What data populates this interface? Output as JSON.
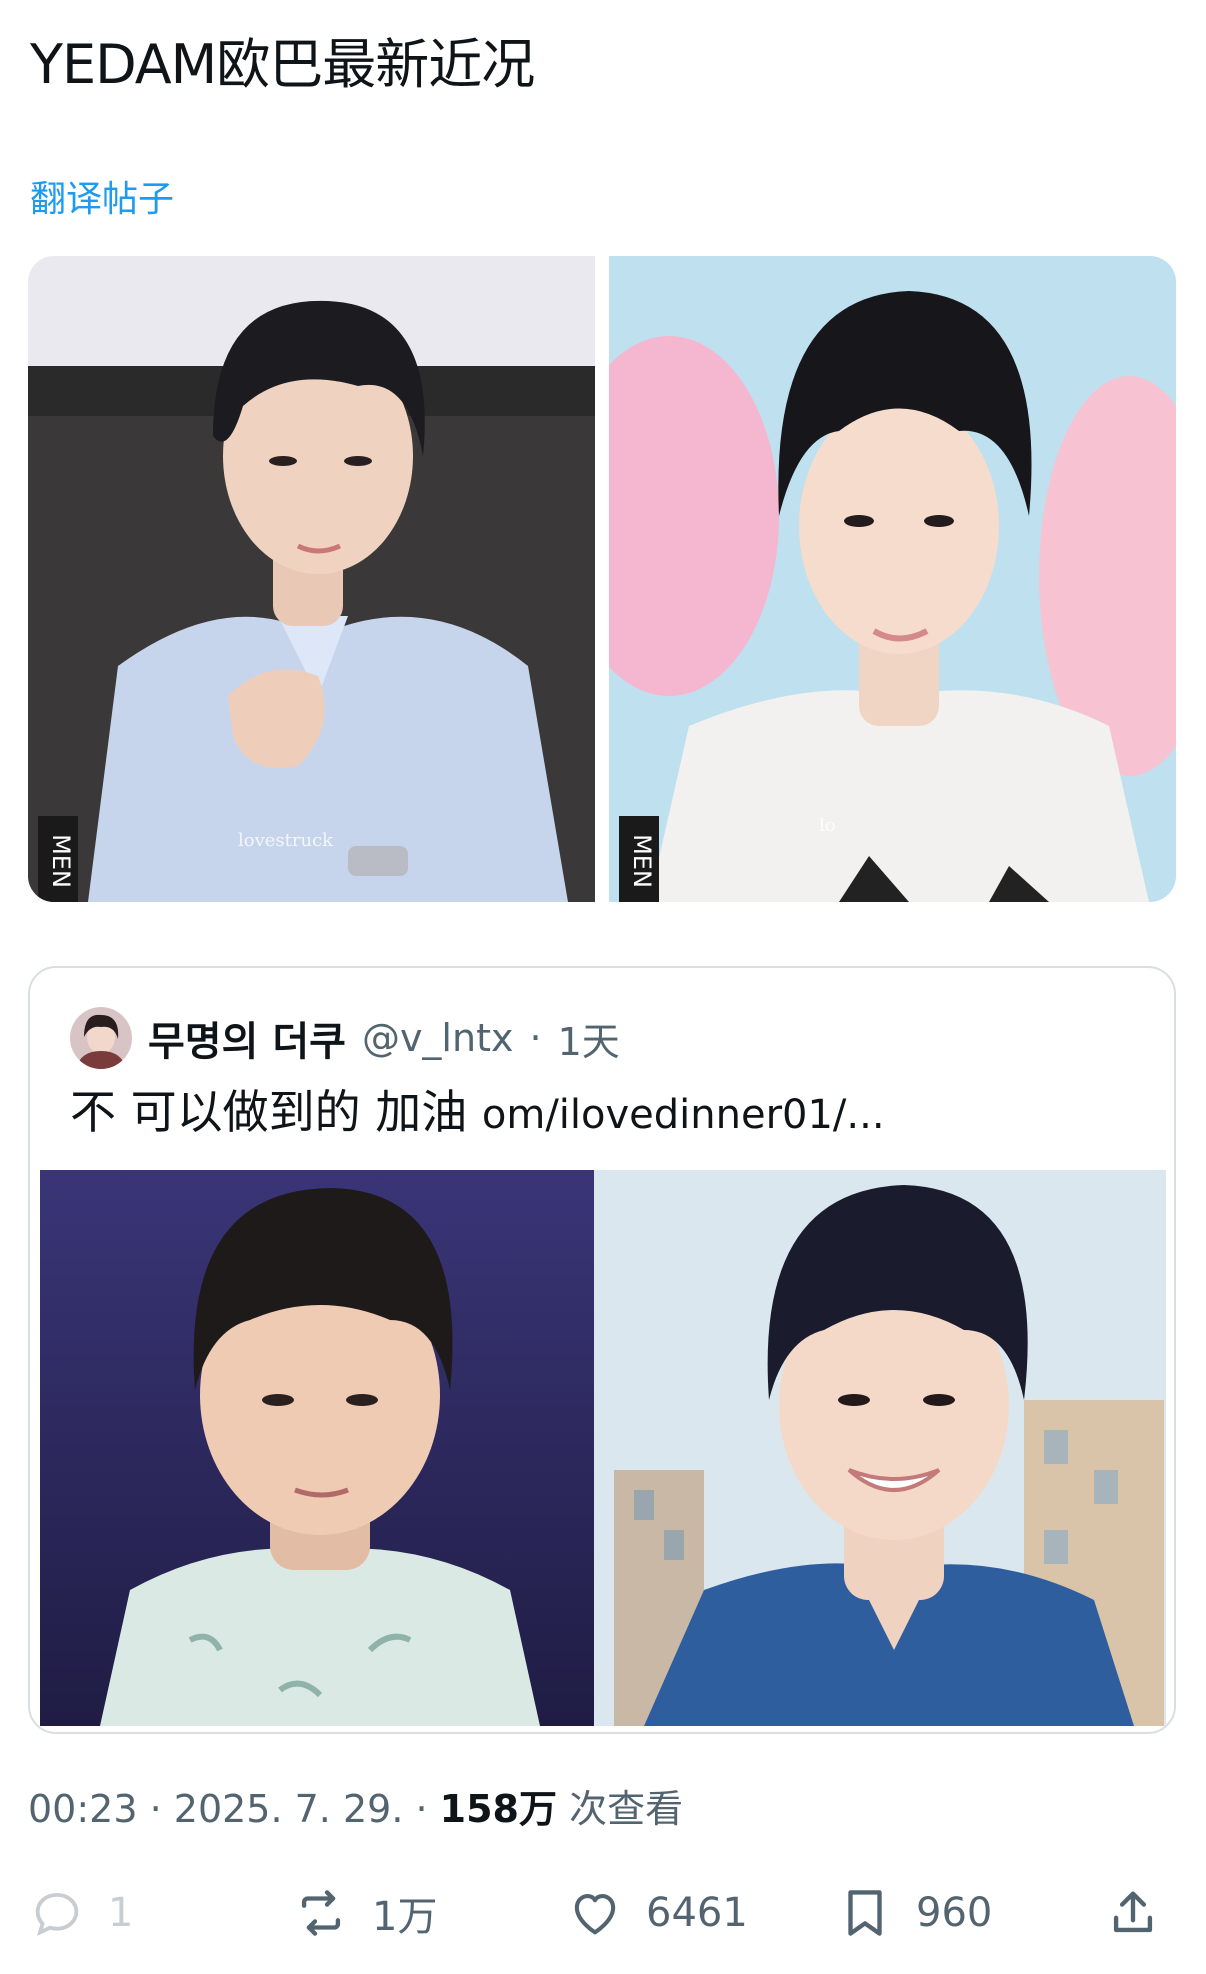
{
  "post": {
    "text": "YEDAM欧巴最新近况",
    "translate_label": "翻译帖子"
  },
  "media": {
    "left_watermark": "MEN",
    "right_watermark": "MEN",
    "left_caption": "lovestruck",
    "right_caption": "lo"
  },
  "quote": {
    "name": "무명의 더쿠",
    "handle": "@v_lntx",
    "separator": "·",
    "time": "1天",
    "text": "不 可以做到的 加油",
    "link": "om/ilovedinner01/..."
  },
  "meta": {
    "time": "00:23",
    "sep1": " · ",
    "date": "2025. 7. 29.",
    "sep2": " · ",
    "views_count": "158万",
    "views_label": " 次查看"
  },
  "actions": {
    "reply_count": "1",
    "repost_count": "1万",
    "like_count": "6461",
    "bookmark_count": "960"
  },
  "colors": {
    "link": "#1d9bf0",
    "secondary": "#536471",
    "primary_text": "#0f1419"
  },
  "icons": [
    "reply-icon",
    "repost-icon",
    "like-icon",
    "bookmark-icon",
    "share-icon"
  ]
}
